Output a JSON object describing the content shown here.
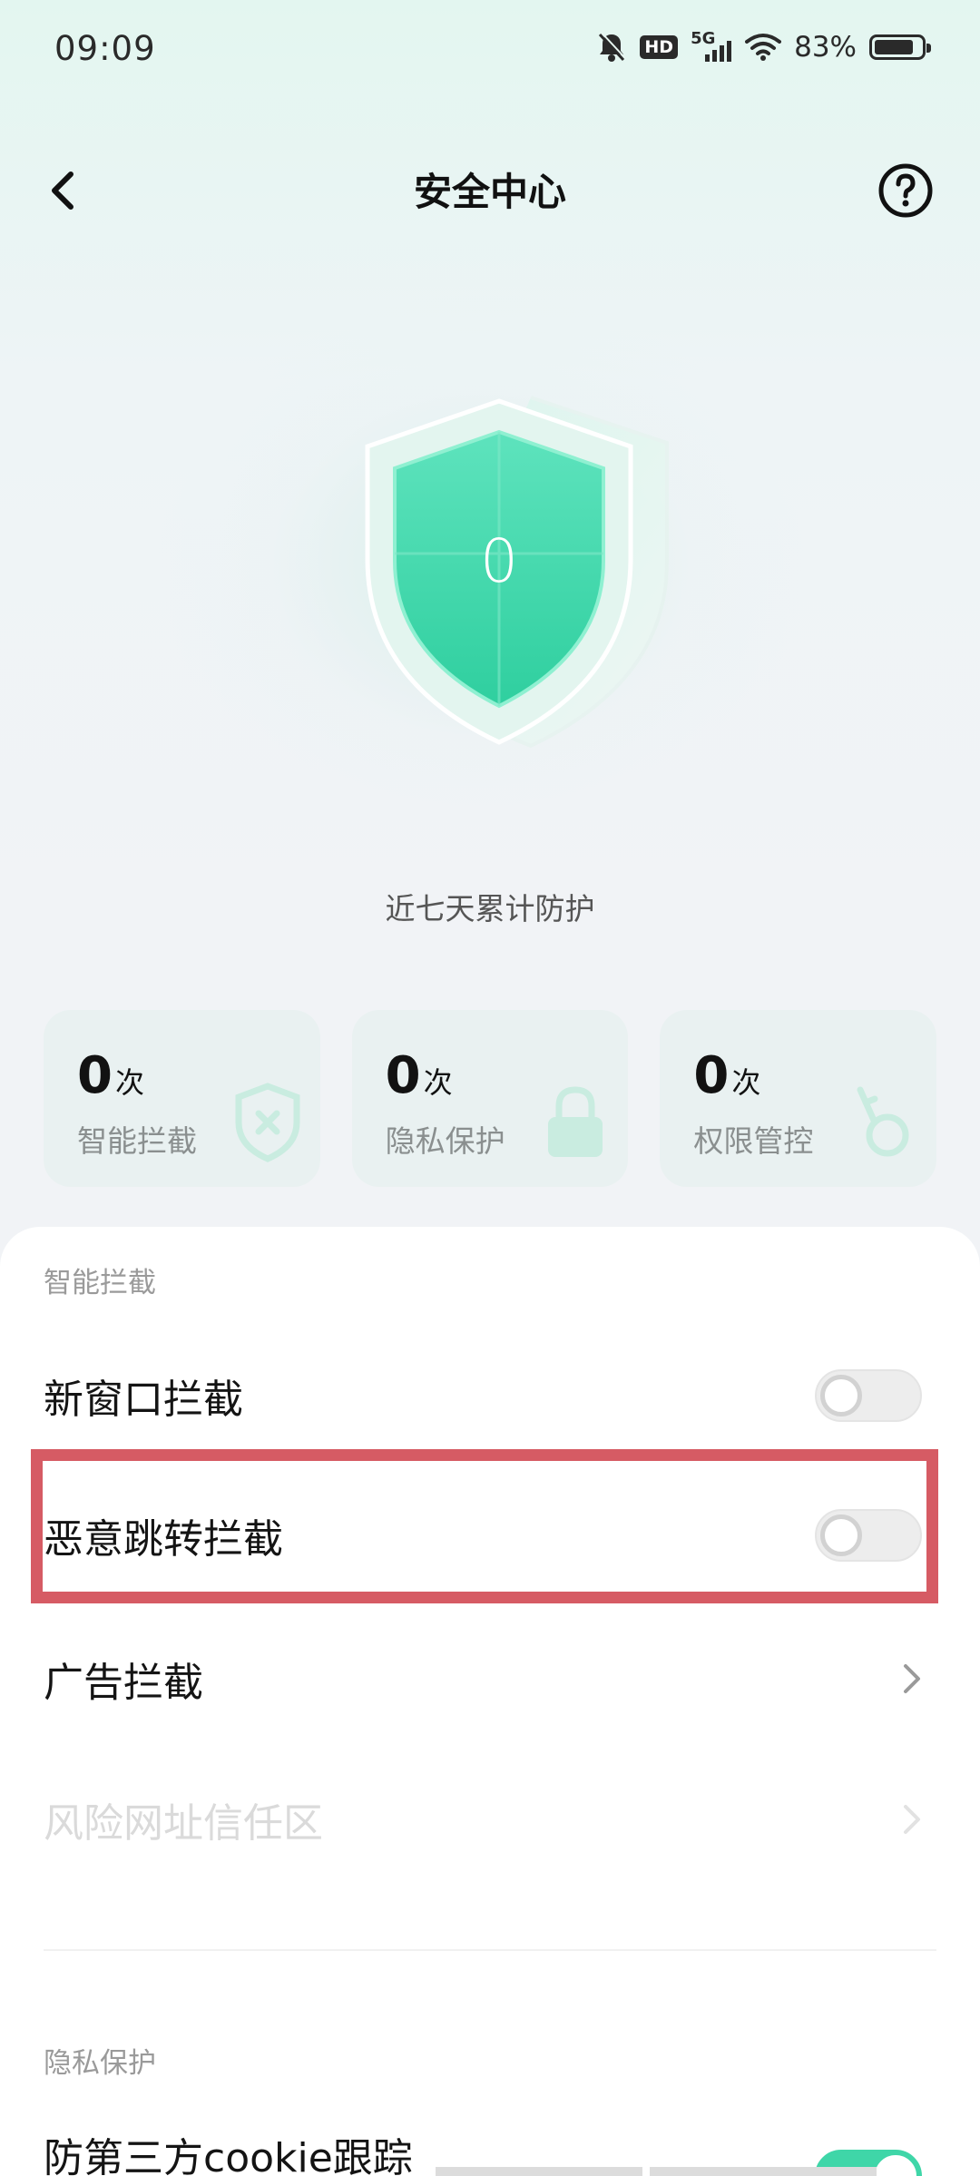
{
  "status_bar": {
    "time": "09:09",
    "network_label": "5G",
    "hd_label": "HD",
    "battery_percent": "83%",
    "battery_level": 0.83
  },
  "header": {
    "title": "安全中心"
  },
  "hero": {
    "protection_count": "0",
    "caption": "近七天累计防护"
  },
  "stats": [
    {
      "value": "0",
      "unit": "次",
      "label": "智能拦截",
      "icon": "shield-x-icon"
    },
    {
      "value": "0",
      "unit": "次",
      "label": "隐私保护",
      "icon": "lock-icon"
    },
    {
      "value": "0",
      "unit": "次",
      "label": "权限管控",
      "icon": "key-icon"
    }
  ],
  "sections": {
    "smart_block": {
      "title": "智能拦截",
      "items": [
        {
          "label": "新窗口拦截",
          "control": "toggle",
          "enabled": false
        },
        {
          "label": "恶意跳转拦截",
          "control": "toggle",
          "enabled": false
        },
        {
          "label": "广告拦截",
          "control": "chevron"
        },
        {
          "label": "风险网址信任区",
          "control": "chevron",
          "disabled": true
        }
      ]
    },
    "privacy": {
      "title": "隐私保护",
      "items": [
        {
          "label": "防第三方cookie跟踪",
          "control": "toggle",
          "enabled": true
        }
      ]
    }
  },
  "colors": {
    "accent": "#3fd6a8",
    "highlight_border": "#d65b64",
    "panel_bg": "#ffffff",
    "page_bg": "#f1f3f6"
  }
}
